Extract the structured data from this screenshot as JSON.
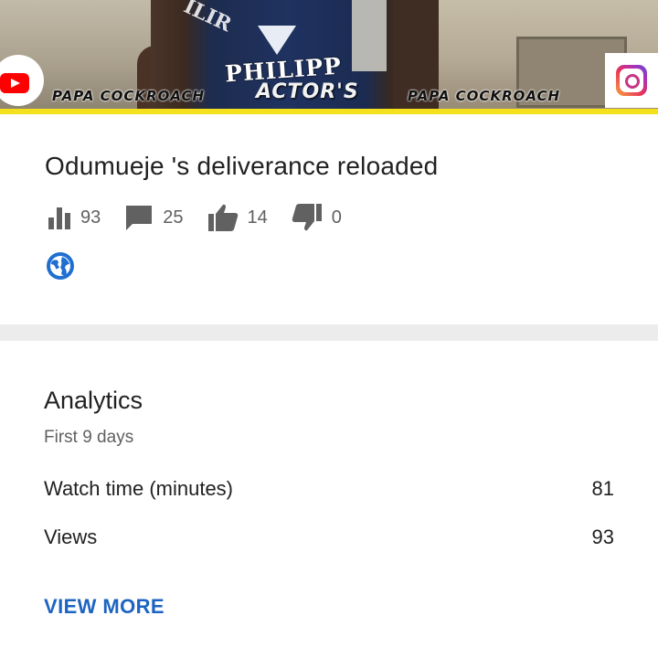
{
  "thumbnail": {
    "watermark_left": "PAPA COCKROACH",
    "watermark_right": "PAPA COCKROACH",
    "shirt_text": "PHILIPP",
    "shirt_text_top": "ILIR",
    "overlay_text": "ACTOR'S",
    "accent_line_color": "#f4e01d"
  },
  "video": {
    "title": "Odumueje 's deliverance reloaded",
    "stats": {
      "views": "93",
      "comments": "25",
      "likes": "14",
      "dislikes": "0"
    },
    "privacy_icon": "globe-icon"
  },
  "analytics": {
    "title": "Analytics",
    "subtitle": "First 9 days",
    "rows": [
      {
        "label": "Watch time (minutes)",
        "value": "81"
      },
      {
        "label": "Views",
        "value": "93"
      }
    ],
    "view_more_label": "VIEW MORE"
  },
  "colors": {
    "link": "#1d64c2",
    "icon_gray": "#616161",
    "globe_blue": "#1f6fd1"
  }
}
